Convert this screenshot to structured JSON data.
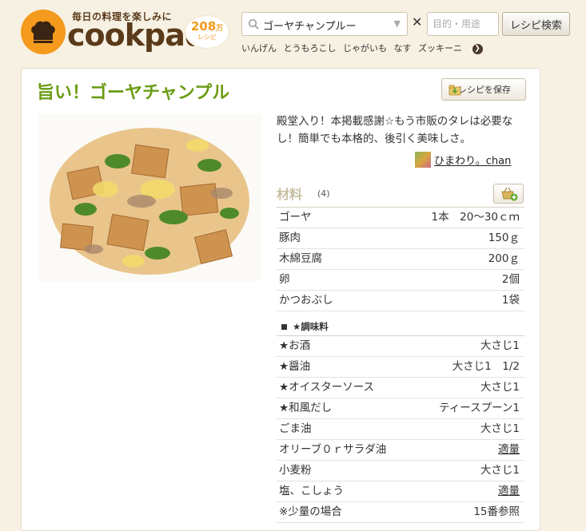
{
  "header": {
    "logo_tagline": "毎日の料理を楽しみに",
    "logo_text": "cookpad",
    "recipe_count": "208",
    "recipe_count_unit": "万",
    "recipe_count_sub": "レシピ",
    "search_value": "ゴーヤチャンプルー",
    "purpose_placeholder": "目的・用途",
    "search_button": "レシピ検索",
    "keywords": [
      "いんげん",
      "とうもろこし",
      "じゃがいも",
      "なす",
      "ズッキーニ"
    ]
  },
  "recipe": {
    "title": "旨い！ゴーヤチャンプル",
    "save_button": "レシピを保存",
    "description": "殿堂入り！本掲載感謝☆もう市販のタレは必要なし！簡単でも本格的、後引く美味しさ。",
    "author": "ひまわり。chan"
  },
  "ingredients": {
    "heading": "材料",
    "servings": "(4)",
    "items": [
      {
        "name": "ゴーヤ",
        "amount": "1本　20〜30ｃｍ"
      },
      {
        "name": "豚肉",
        "amount": "150ｇ"
      },
      {
        "name": "木綿豆腐",
        "amount": "200ｇ"
      },
      {
        "name": "卵",
        "amount": "2個"
      },
      {
        "name": "かつおぶし",
        "amount": "1袋"
      }
    ],
    "seasoning_heading": "★調味料",
    "seasonings": [
      {
        "name": "★お酒",
        "amount": "大さじ1"
      },
      {
        "name": "★醤油",
        "amount": "大さじ1　1/2"
      },
      {
        "name": "★オイスターソース",
        "amount": "大さじ1"
      },
      {
        "name": "★和風だし",
        "amount": "ティースプーン1"
      },
      {
        "name": "ごま油",
        "amount": "大さじ1"
      },
      {
        "name": "オリーブ０ｒサラダ油",
        "amount": "適量"
      },
      {
        "name": "小麦粉",
        "amount": "大さじ1"
      },
      {
        "name": "塩、こしょう",
        "amount": "適量"
      },
      {
        "name": "※少量の場合",
        "amount": "15番参照"
      }
    ]
  },
  "colors": {
    "accent_orange": "#f49a1c",
    "title_green": "#6b9c13",
    "page_bg": "#f7f1e3"
  }
}
